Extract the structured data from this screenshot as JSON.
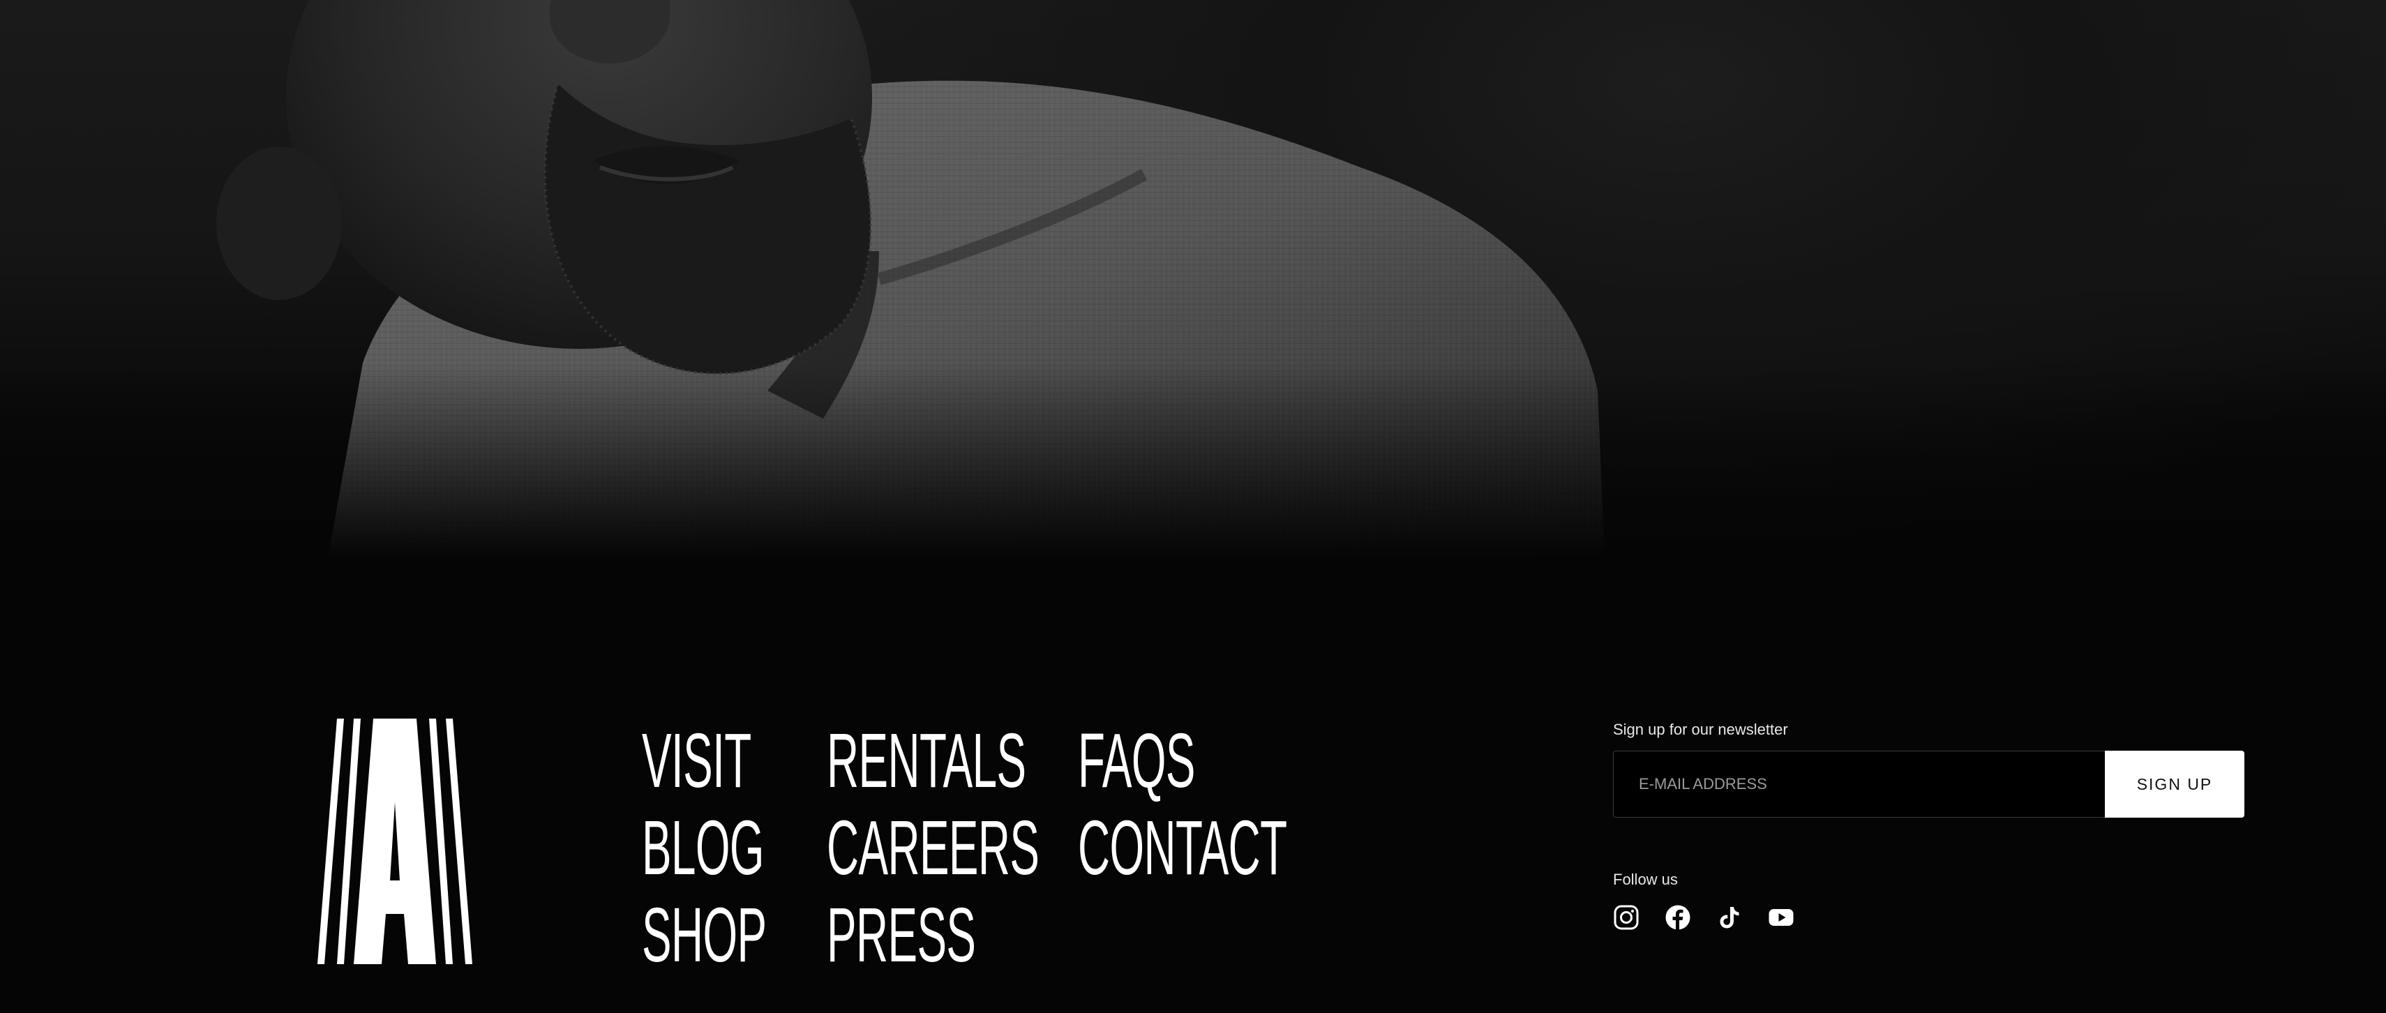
{
  "hero": {
    "image": "portrait-photo"
  },
  "footer": {
    "logo": {
      "letter": "A"
    },
    "nav": [
      {
        "label": "VISIT"
      },
      {
        "label": "RENTALS"
      },
      {
        "label": "FAQS"
      },
      {
        "label": "BLOG"
      },
      {
        "label": "CAREERS"
      },
      {
        "label": "CONTACT"
      },
      {
        "label": "SHOP"
      },
      {
        "label": "PRESS"
      }
    ],
    "newsletter": {
      "label": "Sign up for our newsletter",
      "placeholder": "E-MAIL ADDRESS",
      "value": "",
      "button": "SIGN UP"
    },
    "follow": {
      "label": "Follow us",
      "icons": [
        "instagram-icon",
        "facebook-icon",
        "tiktok-icon",
        "youtube-icon"
      ]
    }
  },
  "colors": {
    "background": "#050505",
    "text": "#ffffff",
    "button_bg": "#ffffff",
    "button_text": "#111111"
  }
}
